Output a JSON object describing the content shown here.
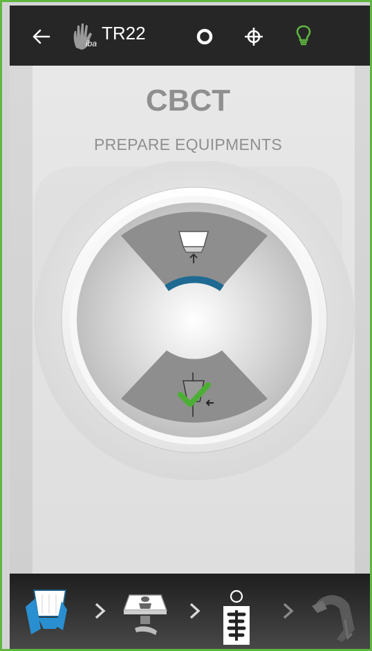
{
  "header": {
    "back_icon": "arrow-left-icon",
    "logo_icon": "iba-hand-logo-icon",
    "logo_text": "iba",
    "room": "TR22",
    "status_icons": [
      "ring-icon",
      "crosshair-icon",
      "lightbulb-icon"
    ],
    "lightbulb_color": "#5fb640"
  },
  "main": {
    "title": "CBCT",
    "subtitle": "PREPARE EQUIPMENTS",
    "dial": {
      "upper_icon": "detector-up-icon",
      "lower_icon": "xray-source-icon",
      "lower_status_icon": "checkmark-icon",
      "arc_color": "#1e6a92"
    }
  },
  "workflow": {
    "steps": [
      {
        "icon": "detector-step-icon",
        "active": true
      },
      {
        "icon": "patient-table-step-icon",
        "active": false
      },
      {
        "icon": "patient-xray-step-icon",
        "active": false
      },
      {
        "icon": "gantry-rotation-step-icon",
        "active": false
      }
    ],
    "separator_icon": "chevron-right-icon",
    "active_color": "#2a8fd0"
  }
}
